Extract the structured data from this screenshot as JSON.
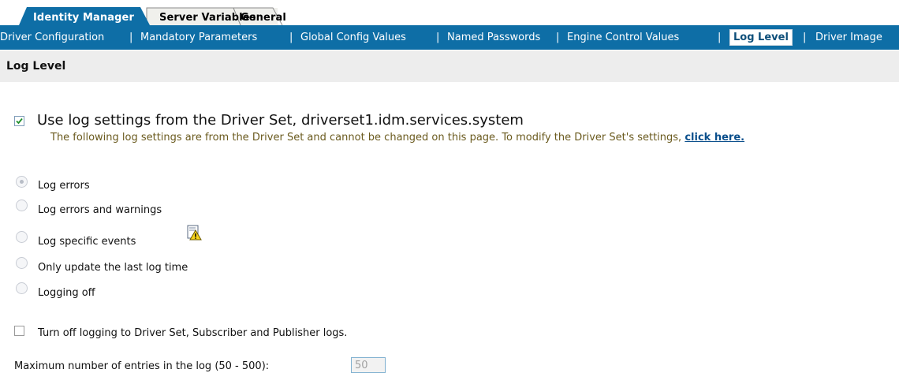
{
  "tabs": [
    {
      "label": "Identity Manager",
      "active": true
    },
    {
      "label": "Server Variables",
      "active": false
    },
    {
      "label": "General",
      "active": false
    }
  ],
  "subnav": {
    "items": [
      "Driver Configuration",
      "Mandatory Parameters",
      "Global Config Values",
      "Named Passwords",
      "Engine Control Values",
      "Log Level",
      "Driver Image"
    ],
    "separator": "|",
    "selected": "Log Level"
  },
  "section": {
    "title": "Log Level"
  },
  "use_driver_set": {
    "checked": true,
    "label": "Use log settings from the Driver Set, driverset1.idm.services.system",
    "note": "The following log settings are from the Driver Set and cannot be changed on this page. To modify the Driver Set's settings,",
    "link": "click here."
  },
  "log_options": [
    {
      "label": "Log errors",
      "selected": true
    },
    {
      "label": "Log errors and warnings",
      "selected": false
    },
    {
      "label": "Log specific events",
      "selected": false
    },
    {
      "label": "Only update the last log time",
      "selected": false
    },
    {
      "label": "Logging off",
      "selected": false
    }
  ],
  "turn_off": {
    "checked": false,
    "label": "Turn off logging to Driver Set, Subscriber and Publisher logs."
  },
  "max_entries": {
    "label": "Maximum number of entries in the log (50 - 500):",
    "value": "50"
  },
  "colors": {
    "nav_blue": "#0e6ea6",
    "tab_active": "#0e6ea6",
    "tab_inactive": "#f0f0ec",
    "note_text": "#6a5a1e"
  },
  "icons": {
    "check": "checkmark-icon",
    "warning": "warning-document-icon"
  }
}
